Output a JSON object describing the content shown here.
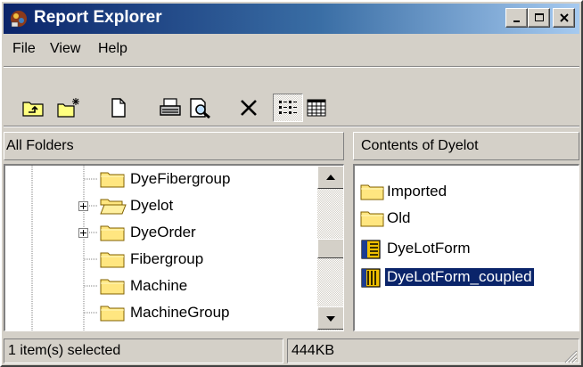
{
  "window": {
    "title": "Report Explorer"
  },
  "menu": {
    "items": [
      "File",
      "View",
      "Help"
    ]
  },
  "toolbar": {
    "tools": [
      "up-folder",
      "new-folder",
      "new-report",
      "print",
      "print-preview",
      "delete",
      "list-view",
      "details-view"
    ]
  },
  "left_panel": {
    "header": "All Folders",
    "tree": [
      {
        "label": "DyeFibergroup",
        "expandable": false
      },
      {
        "label": "Dyelot",
        "expandable": true,
        "open": true
      },
      {
        "label": "DyeOrder",
        "expandable": true
      },
      {
        "label": "Fibergroup",
        "expandable": false
      },
      {
        "label": "Machine",
        "expandable": false
      },
      {
        "label": "MachineGroup",
        "expandable": false
      }
    ]
  },
  "right_panel": {
    "header": "Contents of Dyelot",
    "items": [
      {
        "label": "Imported",
        "type": "folder"
      },
      {
        "label": "Old",
        "type": "folder"
      },
      {
        "label": "DyeLotForm",
        "type": "report"
      },
      {
        "label": "DyeLotForm_coupled",
        "type": "report-coupled",
        "selected": true
      }
    ]
  },
  "status": {
    "selection": "1 item(s) selected",
    "size": "444KB"
  },
  "colors": {
    "titlebar_start": "#0a246a",
    "titlebar_end": "#a6caf0",
    "selection": "#0a246a",
    "face": "#d4d0c8"
  }
}
